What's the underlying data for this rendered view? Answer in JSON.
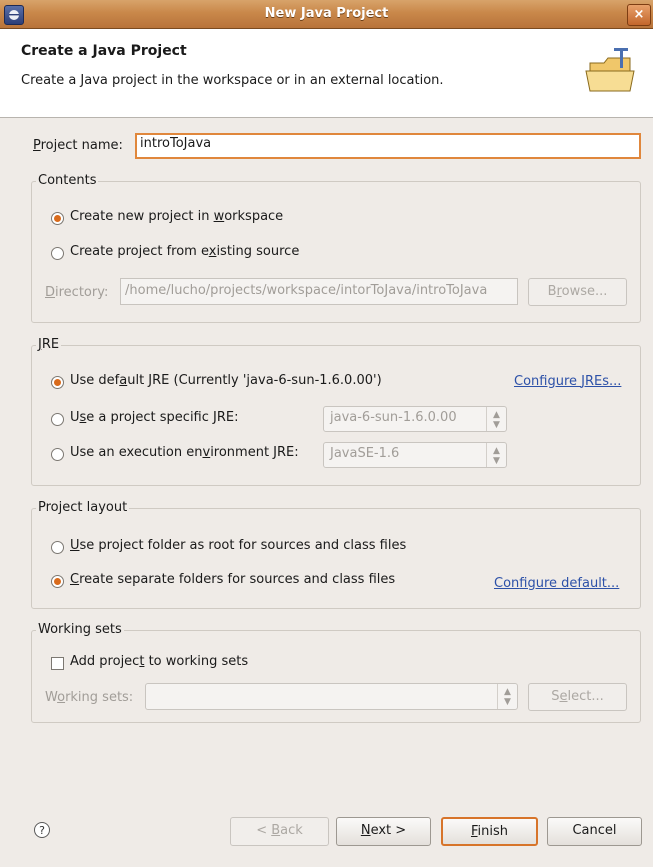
{
  "window": {
    "title": "New Java Project",
    "close": "×"
  },
  "header": {
    "title": "Create a Java Project",
    "description": "Create a Java project in the workspace or in an external location."
  },
  "project_name": {
    "label_pre": "",
    "label_mn": "P",
    "label_post": "roject name:",
    "value": "introToJava"
  },
  "contents": {
    "legend": "Contents",
    "option_new": {
      "pre": "Create new project in ",
      "mn": "w",
      "post": "orkspace",
      "checked": true
    },
    "option_existing": {
      "pre": "Create project from e",
      "mn": "x",
      "post": "isting source",
      "checked": false
    },
    "directory": {
      "label_mn": "D",
      "label_post": "irectory:",
      "value": "/home/lucho/projects/workspace/intorToJava/introToJava",
      "browse_pre": "B",
      "browse_mn": "r",
      "browse_post": "owse..."
    }
  },
  "jre": {
    "legend_mn": "J",
    "legend_post": "RE",
    "option_default": {
      "pre": "Use def",
      "mn": "a",
      "post": "ult JRE (Currently 'java-6-sun-1.6.0.00')",
      "checked": true
    },
    "configure_jres": {
      "pre": "Configure ",
      "mn": "J",
      "post": "REs..."
    },
    "option_specific": {
      "pre": "U",
      "mn": "s",
      "post": "e a project specific JRE:",
      "checked": false
    },
    "specific_value": "java-6-sun-1.6.0.00",
    "option_env": {
      "pre": "Use an execution en",
      "mn": "v",
      "post": "ironment JRE:",
      "checked": false
    },
    "env_value": "JavaSE-1.6"
  },
  "layout": {
    "legend": "Project layout",
    "option_root": {
      "pre": "",
      "mn": "U",
      "post": "se project folder as root for sources and class files",
      "checked": false
    },
    "option_separate": {
      "pre": "",
      "mn": "C",
      "post": "reate separate folders for sources and class files",
      "checked": true
    },
    "configure_default": {
      "pre": "Con",
      "mn": "f",
      "post": "igure default..."
    }
  },
  "working_sets": {
    "legend": "Working sets",
    "add": {
      "pre": "Add projec",
      "mn": "t",
      "post": " to working sets",
      "checked": false
    },
    "label": {
      "pre": "W",
      "mn": "o",
      "post": "rking sets:"
    },
    "select": {
      "pre": "S",
      "mn": "e",
      "post": "lect..."
    }
  },
  "footer": {
    "help": "?",
    "back": {
      "pre": "< ",
      "mn": "B",
      "post": "ack"
    },
    "next": {
      "pre": "",
      "mn": "N",
      "post": "ext >"
    },
    "finish": {
      "pre": "",
      "mn": "F",
      "post": "inish"
    },
    "cancel": "Cancel"
  }
}
